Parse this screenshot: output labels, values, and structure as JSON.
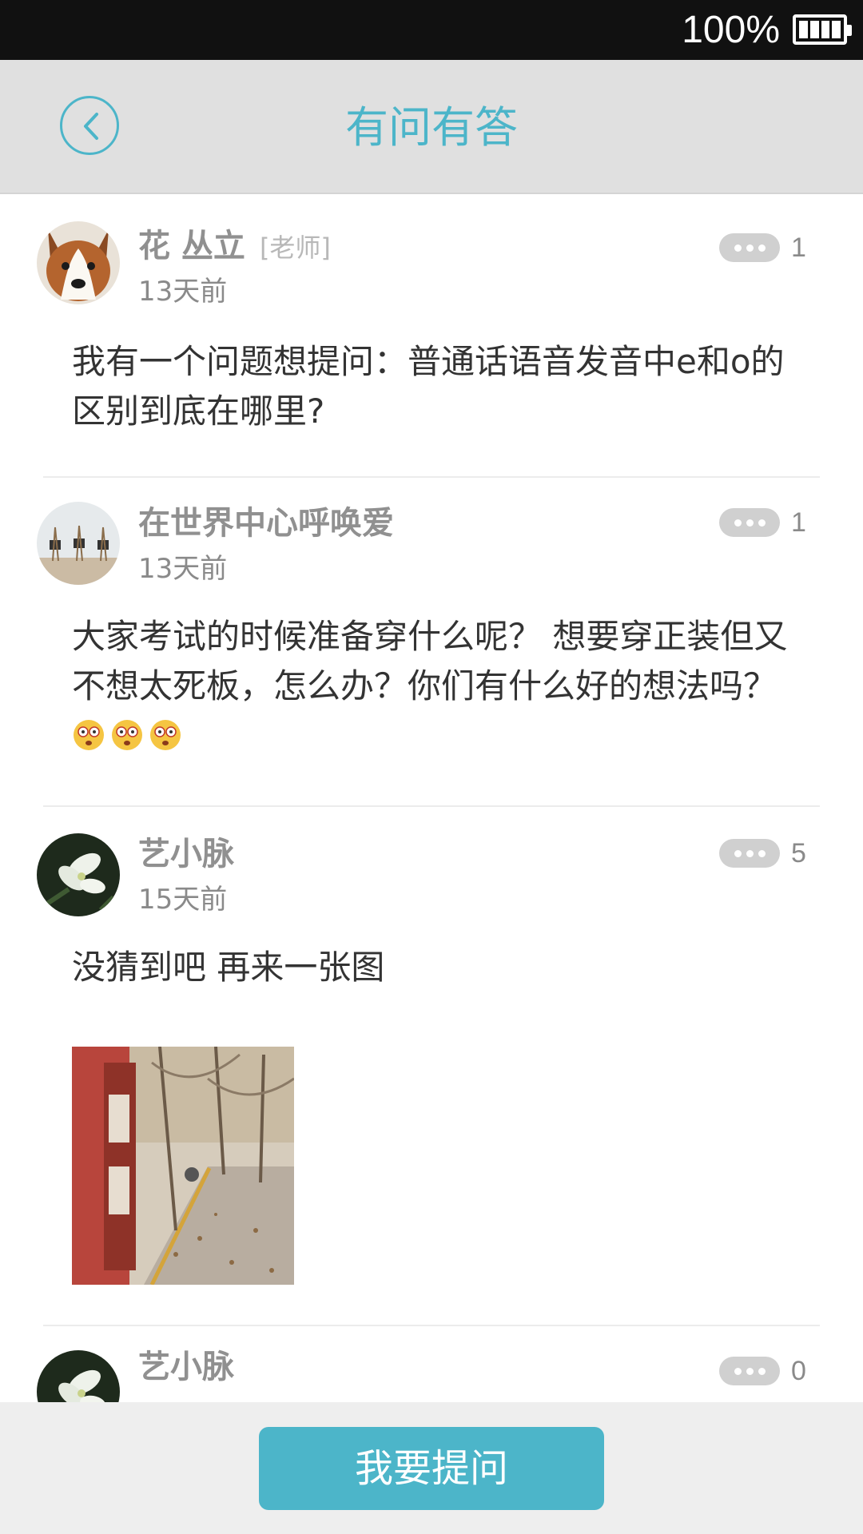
{
  "status": {
    "battery_percent": "100%"
  },
  "header": {
    "title": "有问有答",
    "back_icon": "chevron-left-icon"
  },
  "posts": [
    {
      "username": "花 丛立",
      "role": "[老师]",
      "time": "13天前",
      "reply_count": "1",
      "content": "我有一个问题想提问：普通话语音发音中e和o的区别到底在哪里?"
    },
    {
      "username": "在世界中心呼唤爱",
      "time": "13天前",
      "reply_count": "1",
      "content": "大家考试的时候准备穿什么呢？ 想要穿正装但又不想太死板，怎么办？你们有什么好的想法吗？",
      "emoji_count": 3
    },
    {
      "username": "艺小脉",
      "time": "15天前",
      "reply_count": "5",
      "content": "没猜到吧 再来一张图",
      "has_image": true
    },
    {
      "username": "艺小脉",
      "reply_count": "0"
    }
  ],
  "bottom": {
    "ask_button": "我要提问"
  },
  "colors": {
    "accent": "#4cb5c9",
    "header_bg": "#e0e0e0",
    "status_bar": "#111111"
  }
}
